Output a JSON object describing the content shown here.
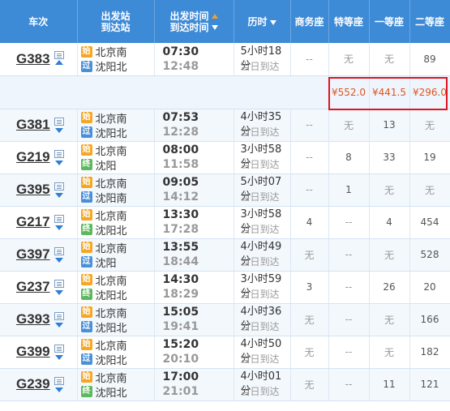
{
  "header": {
    "train_no": "车次",
    "stations": [
      "出发站",
      "到达站"
    ],
    "times": [
      "出发时间",
      "到达时间"
    ],
    "duration": "历时",
    "business": "商务座",
    "special": "特等座",
    "first": "一等座",
    "second": "二等座"
  },
  "trains": [
    {
      "no": "G383",
      "from": "北京南",
      "to": "沈阳北",
      "to_type": "过",
      "dep": "07:30",
      "arr": "12:48",
      "dur": "5小时18分",
      "arrive": "当日到达",
      "business": "--",
      "special": "无",
      "first": "无",
      "second": "89",
      "expanded": true
    },
    {
      "no": "G381",
      "from": "北京南",
      "to": "沈阳北",
      "to_type": "过",
      "dep": "07:53",
      "arr": "12:28",
      "dur": "4小时35分",
      "arrive": "当日到达",
      "business": "--",
      "special": "无",
      "first": "13",
      "second": "无"
    },
    {
      "no": "G219",
      "from": "北京南",
      "to": "沈阳",
      "to_type": "终",
      "dep": "08:00",
      "arr": "11:58",
      "dur": "3小时58分",
      "arrive": "当日到达",
      "business": "--",
      "special": "8",
      "first": "33",
      "second": "19"
    },
    {
      "no": "G395",
      "from": "北京南",
      "to": "沈阳南",
      "to_type": "过",
      "dep": "09:05",
      "arr": "14:12",
      "dur": "5小时07分",
      "arrive": "当日到达",
      "business": "--",
      "special": "1",
      "first": "无",
      "second": "无"
    },
    {
      "no": "G217",
      "from": "北京南",
      "to": "沈阳北",
      "to_type": "终",
      "dep": "13:30",
      "arr": "17:28",
      "dur": "3小时58分",
      "arrive": "当日到达",
      "business": "4",
      "special": "--",
      "first": "4",
      "second": "454"
    },
    {
      "no": "G397",
      "from": "北京南",
      "to": "沈阳",
      "to_type": "过",
      "dep": "13:55",
      "arr": "18:44",
      "dur": "4小时49分",
      "arrive": "当日到达",
      "business": "无",
      "special": "--",
      "first": "无",
      "second": "528"
    },
    {
      "no": "G237",
      "from": "北京南",
      "to": "沈阳北",
      "to_type": "终",
      "dep": "14:30",
      "arr": "18:29",
      "dur": "3小时59分",
      "arrive": "当日到达",
      "business": "3",
      "special": "--",
      "first": "26",
      "second": "20"
    },
    {
      "no": "G393",
      "from": "北京南",
      "to": "沈阳北",
      "to_type": "过",
      "dep": "15:05",
      "arr": "19:41",
      "dur": "4小时36分",
      "arrive": "当日到达",
      "business": "无",
      "special": "--",
      "first": "无",
      "second": "166"
    },
    {
      "no": "G399",
      "from": "北京南",
      "to": "沈阳北",
      "to_type": "过",
      "dep": "15:20",
      "arr": "20:10",
      "dur": "4小时50分",
      "arrive": "当日到达",
      "business": "无",
      "special": "--",
      "first": "无",
      "second": "182"
    },
    {
      "no": "G239",
      "from": "北京南",
      "to": "沈阳北",
      "to_type": "终",
      "dep": "17:00",
      "arr": "21:01",
      "dur": "4小时01分",
      "arrive": "当日到达",
      "business": "无",
      "special": "--",
      "first": "11",
      "second": "121"
    }
  ],
  "badges": {
    "start": "始"
  },
  "prices": {
    "special": "¥552.0",
    "first": "¥441.5",
    "second": "¥296.0"
  },
  "colors": {
    "header": "#3d8ad6",
    "price": "#e0541e",
    "highlight_border": "#e0141e"
  }
}
